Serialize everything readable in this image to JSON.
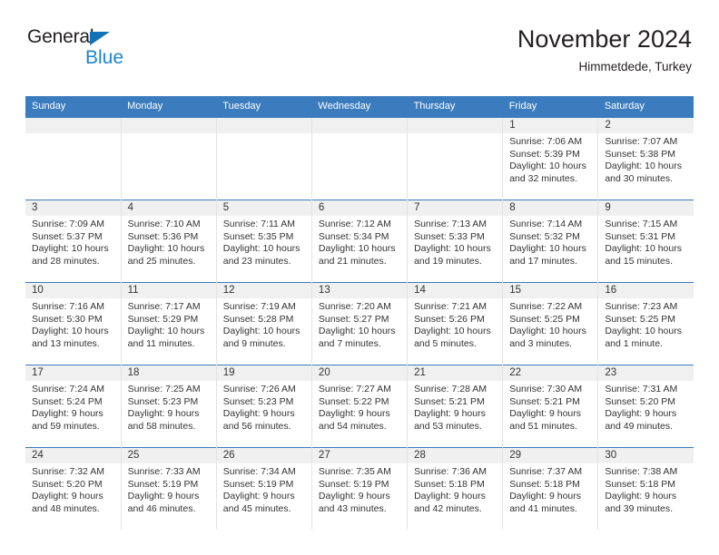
{
  "brand": {
    "name_part1": "General",
    "name_part2": "Blue",
    "triangle_icon": "blue-triangle-logo-icon",
    "accent_color": "#1b86d1",
    "logo_dark_color": "#231f20"
  },
  "header": {
    "title": "November 2024",
    "subtitle": "Himmetdede, Turkey"
  },
  "theme": {
    "header_row_bg": "#3b7cbe",
    "header_row_text": "#ffffff",
    "daynum_band_bg": "#f0f0f0",
    "cell_bg": "#ffffff",
    "row_divider": "#3b7cbe",
    "cell_divider": "#e3e3e3"
  },
  "calendar": {
    "weekday_headers": [
      "Sunday",
      "Monday",
      "Tuesday",
      "Wednesday",
      "Thursday",
      "Friday",
      "Saturday"
    ],
    "weeks": [
      [
        {
          "day": "",
          "sunrise": "",
          "sunset": "",
          "daylight_line1": "",
          "daylight_line2": ""
        },
        {
          "day": "",
          "sunrise": "",
          "sunset": "",
          "daylight_line1": "",
          "daylight_line2": ""
        },
        {
          "day": "",
          "sunrise": "",
          "sunset": "",
          "daylight_line1": "",
          "daylight_line2": ""
        },
        {
          "day": "",
          "sunrise": "",
          "sunset": "",
          "daylight_line1": "",
          "daylight_line2": ""
        },
        {
          "day": "",
          "sunrise": "",
          "sunset": "",
          "daylight_line1": "",
          "daylight_line2": ""
        },
        {
          "day": "1",
          "sunrise": "Sunrise: 7:06 AM",
          "sunset": "Sunset: 5:39 PM",
          "daylight_line1": "Daylight: 10 hours",
          "daylight_line2": "and 32 minutes."
        },
        {
          "day": "2",
          "sunrise": "Sunrise: 7:07 AM",
          "sunset": "Sunset: 5:38 PM",
          "daylight_line1": "Daylight: 10 hours",
          "daylight_line2": "and 30 minutes."
        }
      ],
      [
        {
          "day": "3",
          "sunrise": "Sunrise: 7:09 AM",
          "sunset": "Sunset: 5:37 PM",
          "daylight_line1": "Daylight: 10 hours",
          "daylight_line2": "and 28 minutes."
        },
        {
          "day": "4",
          "sunrise": "Sunrise: 7:10 AM",
          "sunset": "Sunset: 5:36 PM",
          "daylight_line1": "Daylight: 10 hours",
          "daylight_line2": "and 25 minutes."
        },
        {
          "day": "5",
          "sunrise": "Sunrise: 7:11 AM",
          "sunset": "Sunset: 5:35 PM",
          "daylight_line1": "Daylight: 10 hours",
          "daylight_line2": "and 23 minutes."
        },
        {
          "day": "6",
          "sunrise": "Sunrise: 7:12 AM",
          "sunset": "Sunset: 5:34 PM",
          "daylight_line1": "Daylight: 10 hours",
          "daylight_line2": "and 21 minutes."
        },
        {
          "day": "7",
          "sunrise": "Sunrise: 7:13 AM",
          "sunset": "Sunset: 5:33 PM",
          "daylight_line1": "Daylight: 10 hours",
          "daylight_line2": "and 19 minutes."
        },
        {
          "day": "8",
          "sunrise": "Sunrise: 7:14 AM",
          "sunset": "Sunset: 5:32 PM",
          "daylight_line1": "Daylight: 10 hours",
          "daylight_line2": "and 17 minutes."
        },
        {
          "day": "9",
          "sunrise": "Sunrise: 7:15 AM",
          "sunset": "Sunset: 5:31 PM",
          "daylight_line1": "Daylight: 10 hours",
          "daylight_line2": "and 15 minutes."
        }
      ],
      [
        {
          "day": "10",
          "sunrise": "Sunrise: 7:16 AM",
          "sunset": "Sunset: 5:30 PM",
          "daylight_line1": "Daylight: 10 hours",
          "daylight_line2": "and 13 minutes."
        },
        {
          "day": "11",
          "sunrise": "Sunrise: 7:17 AM",
          "sunset": "Sunset: 5:29 PM",
          "daylight_line1": "Daylight: 10 hours",
          "daylight_line2": "and 11 minutes."
        },
        {
          "day": "12",
          "sunrise": "Sunrise: 7:19 AM",
          "sunset": "Sunset: 5:28 PM",
          "daylight_line1": "Daylight: 10 hours",
          "daylight_line2": "and 9 minutes."
        },
        {
          "day": "13",
          "sunrise": "Sunrise: 7:20 AM",
          "sunset": "Sunset: 5:27 PM",
          "daylight_line1": "Daylight: 10 hours",
          "daylight_line2": "and 7 minutes."
        },
        {
          "day": "14",
          "sunrise": "Sunrise: 7:21 AM",
          "sunset": "Sunset: 5:26 PM",
          "daylight_line1": "Daylight: 10 hours",
          "daylight_line2": "and 5 minutes."
        },
        {
          "day": "15",
          "sunrise": "Sunrise: 7:22 AM",
          "sunset": "Sunset: 5:25 PM",
          "daylight_line1": "Daylight: 10 hours",
          "daylight_line2": "and 3 minutes."
        },
        {
          "day": "16",
          "sunrise": "Sunrise: 7:23 AM",
          "sunset": "Sunset: 5:25 PM",
          "daylight_line1": "Daylight: 10 hours",
          "daylight_line2": "and 1 minute."
        }
      ],
      [
        {
          "day": "17",
          "sunrise": "Sunrise: 7:24 AM",
          "sunset": "Sunset: 5:24 PM",
          "daylight_line1": "Daylight: 9 hours",
          "daylight_line2": "and 59 minutes."
        },
        {
          "day": "18",
          "sunrise": "Sunrise: 7:25 AM",
          "sunset": "Sunset: 5:23 PM",
          "daylight_line1": "Daylight: 9 hours",
          "daylight_line2": "and 58 minutes."
        },
        {
          "day": "19",
          "sunrise": "Sunrise: 7:26 AM",
          "sunset": "Sunset: 5:23 PM",
          "daylight_line1": "Daylight: 9 hours",
          "daylight_line2": "and 56 minutes."
        },
        {
          "day": "20",
          "sunrise": "Sunrise: 7:27 AM",
          "sunset": "Sunset: 5:22 PM",
          "daylight_line1": "Daylight: 9 hours",
          "daylight_line2": "and 54 minutes."
        },
        {
          "day": "21",
          "sunrise": "Sunrise: 7:28 AM",
          "sunset": "Sunset: 5:21 PM",
          "daylight_line1": "Daylight: 9 hours",
          "daylight_line2": "and 53 minutes."
        },
        {
          "day": "22",
          "sunrise": "Sunrise: 7:30 AM",
          "sunset": "Sunset: 5:21 PM",
          "daylight_line1": "Daylight: 9 hours",
          "daylight_line2": "and 51 minutes."
        },
        {
          "day": "23",
          "sunrise": "Sunrise: 7:31 AM",
          "sunset": "Sunset: 5:20 PM",
          "daylight_line1": "Daylight: 9 hours",
          "daylight_line2": "and 49 minutes."
        }
      ],
      [
        {
          "day": "24",
          "sunrise": "Sunrise: 7:32 AM",
          "sunset": "Sunset: 5:20 PM",
          "daylight_line1": "Daylight: 9 hours",
          "daylight_line2": "and 48 minutes."
        },
        {
          "day": "25",
          "sunrise": "Sunrise: 7:33 AM",
          "sunset": "Sunset: 5:19 PM",
          "daylight_line1": "Daylight: 9 hours",
          "daylight_line2": "and 46 minutes."
        },
        {
          "day": "26",
          "sunrise": "Sunrise: 7:34 AM",
          "sunset": "Sunset: 5:19 PM",
          "daylight_line1": "Daylight: 9 hours",
          "daylight_line2": "and 45 minutes."
        },
        {
          "day": "27",
          "sunrise": "Sunrise: 7:35 AM",
          "sunset": "Sunset: 5:19 PM",
          "daylight_line1": "Daylight: 9 hours",
          "daylight_line2": "and 43 minutes."
        },
        {
          "day": "28",
          "sunrise": "Sunrise: 7:36 AM",
          "sunset": "Sunset: 5:18 PM",
          "daylight_line1": "Daylight: 9 hours",
          "daylight_line2": "and 42 minutes."
        },
        {
          "day": "29",
          "sunrise": "Sunrise: 7:37 AM",
          "sunset": "Sunset: 5:18 PM",
          "daylight_line1": "Daylight: 9 hours",
          "daylight_line2": "and 41 minutes."
        },
        {
          "day": "30",
          "sunrise": "Sunrise: 7:38 AM",
          "sunset": "Sunset: 5:18 PM",
          "daylight_line1": "Daylight: 9 hours",
          "daylight_line2": "and 39 minutes."
        }
      ]
    ]
  }
}
